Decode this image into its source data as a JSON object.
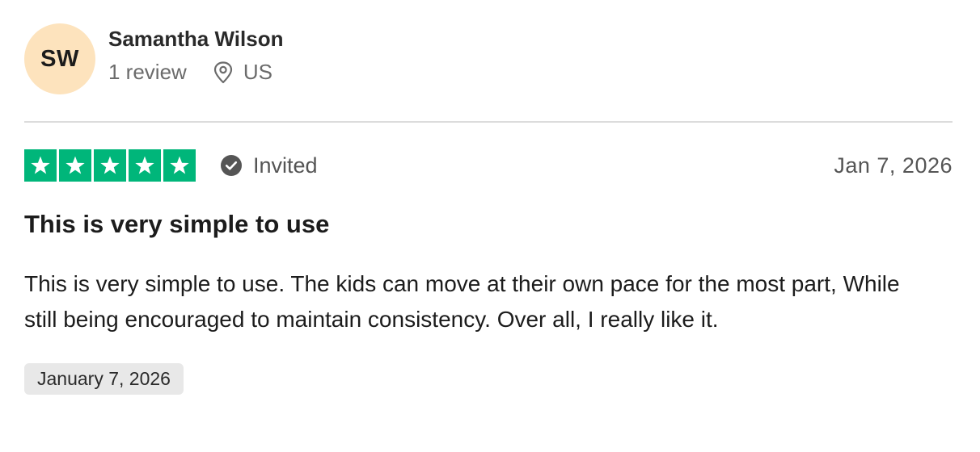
{
  "reviewer": {
    "initials": "SW",
    "name": "Samantha Wilson",
    "review_count": "1 review",
    "location": "US",
    "avatar_color": "#fde3bd"
  },
  "review": {
    "rating": 5,
    "max_rating": 5,
    "star_color": "#00b67a",
    "verification_label": "Invited",
    "verification_icon": "check-circle-icon",
    "location_icon": "map-pin-icon",
    "date": "Jan 7, 2026",
    "title": "This is very simple to use",
    "body": "This is very simple to use. The kids can move at their own pace for the most part, While still being encouraged to maintain consistency. Over all, I really like it.",
    "experience_date": "January 7, 2026"
  }
}
